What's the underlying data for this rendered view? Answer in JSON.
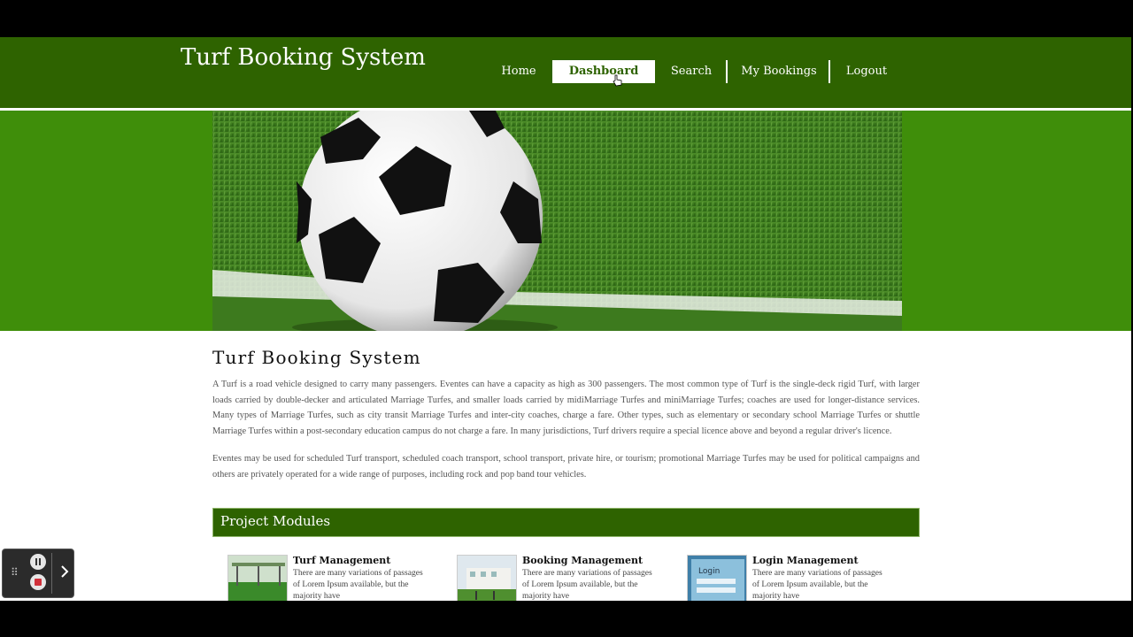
{
  "header": {
    "title": "Turf Booking System",
    "nav": [
      {
        "label": "Home"
      },
      {
        "label": "Dashboard",
        "active": true
      },
      {
        "label": "Search"
      },
      {
        "label": "My Bookings"
      },
      {
        "label": "Logout"
      }
    ]
  },
  "main": {
    "heading": "Turf Booking System",
    "paragraphs": [
      "A Turf is a road vehicle designed to carry many passengers. Eventes can have a capacity as high as 300 passengers. The most common type of Turf is the single-deck rigid Turf, with larger loads carried by double-decker and articulated Marriage Turfes, and smaller loads carried by midiMarriage Turfes and miniMarriage Turfes; coaches are used for longer-distance services. Many types of Marriage Turfes, such as city transit Marriage Turfes and inter-city coaches, charge a fare. Other types, such as elementary or secondary school Marriage Turfes or shuttle Marriage Turfes within a post-secondary education campus do not charge a fare. In many jurisdictions, Turf drivers require a special licence above and beyond a regular driver's licence.",
      "Eventes may be used for scheduled Turf transport, scheduled coach transport, school transport, private hire, or tourism; promotional Marriage Turfes may be used for political campaigns and others are privately operated for a wide range of purposes, including rock and pop band tour vehicles."
    ],
    "modules_title": "Project Modules",
    "modules": [
      {
        "title": "Turf Management",
        "text": "There are many variations of passages of Lorem Ipsum available, but the majority have"
      },
      {
        "title": "Booking Management",
        "text": "There are many variations of passages of Lorem Ipsum available, but the majority have"
      },
      {
        "title": "Login Management",
        "text": "There are many variations of passages of Lorem Ipsum available, but the majority have"
      }
    ]
  },
  "colors": {
    "header_green": "#2e6300",
    "banner_green": "#3f8e0a",
    "text_gray": "#555555"
  },
  "icons": [
    "soccer-ball-banner",
    "pointer-cursor-icon",
    "drag-grip-icon",
    "pause-icon",
    "stop-icon",
    "chevron-right-icon"
  ]
}
